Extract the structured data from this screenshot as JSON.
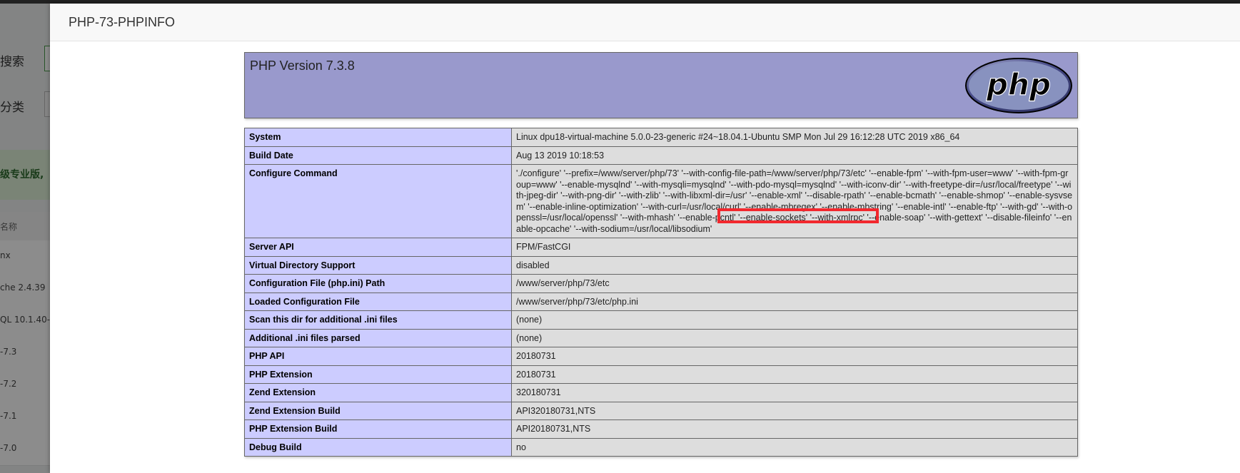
{
  "background": {
    "labels": [
      "搜索",
      "分类"
    ],
    "banner_text": "级专业版,",
    "column_header": "名称",
    "rows": [
      "nx",
      "che 2.4.39",
      "QL 10.1.40-M",
      "-7.3",
      "-7.2",
      "-7.1",
      "-7.0"
    ]
  },
  "modal": {
    "title": "PHP-73-PHPINFO"
  },
  "phpinfo": {
    "version_heading": "PHP Version 7.3.8",
    "logo_text": "php",
    "rows": [
      {
        "key": "System",
        "value": "Linux dpu18-virtual-machine 5.0.0-23-generic #24~18.04.1-Ubuntu SMP Mon Jul 29 16:12:28 UTC 2019 x86_64"
      },
      {
        "key": "Build Date",
        "value": "Aug 13 2019 10:18:53"
      },
      {
        "key": "Configure Command",
        "value": "'./configure' '--prefix=/www/server/php/73' '--with-config-file-path=/www/server/php/73/etc' '--enable-fpm' '--with-fpm-user=www' '--with-fpm-group=www' '--enable-mysqlnd' '--with-mysqli=mysqlnd' '--with-pdo-mysql=mysqlnd' '--with-iconv-dir' '--with-freetype-dir=/usr/local/freetype' '--with-jpeg-dir' '--with-png-dir' '--with-zlib' '--with-libxml-dir=/usr' '--enable-xml' '--disable-rpath' '--enable-bcmath' '--enable-shmop' '--enable-sysvsem' '--enable-inline-optimization' '--with-curl=/usr/local/curl' '--enable-mbregex' '--enable-mbstring' '--enable-intl' '--enable-ftp' '--with-gd' '--with-openssl=/usr/local/openssl' '--with-mhash' '--enable-pcntl' '--enable-sockets' '--with-xmlrpc' '--enable-soap' '--with-gettext' '--disable-fileinfo' '--enable-opcache' '--with-sodium=/usr/local/libsodium'"
      },
      {
        "key": "Server API",
        "value": "FPM/FastCGI"
      },
      {
        "key": "Virtual Directory Support",
        "value": "disabled"
      },
      {
        "key": "Configuration File (php.ini) Path",
        "value": "/www/server/php/73/etc"
      },
      {
        "key": "Loaded Configuration File",
        "value": "/www/server/php/73/etc/php.ini"
      },
      {
        "key": "Scan this dir for additional .ini files",
        "value": "(none)"
      },
      {
        "key": "Additional .ini files parsed",
        "value": "(none)"
      },
      {
        "key": "PHP API",
        "value": "20180731"
      },
      {
        "key": "PHP Extension",
        "value": "20180731"
      },
      {
        "key": "Zend Extension",
        "value": "320180731"
      },
      {
        "key": "Zend Extension Build",
        "value": "API320180731,NTS"
      },
      {
        "key": "PHP Extension Build",
        "value": "API20180731,NTS"
      },
      {
        "key": "Debug Build",
        "value": "no"
      }
    ]
  },
  "colors": {
    "header_bg": "#9999cc",
    "key_bg": "#ccccff",
    "value_bg": "#dddddd",
    "highlight_border": "#f2282e"
  }
}
